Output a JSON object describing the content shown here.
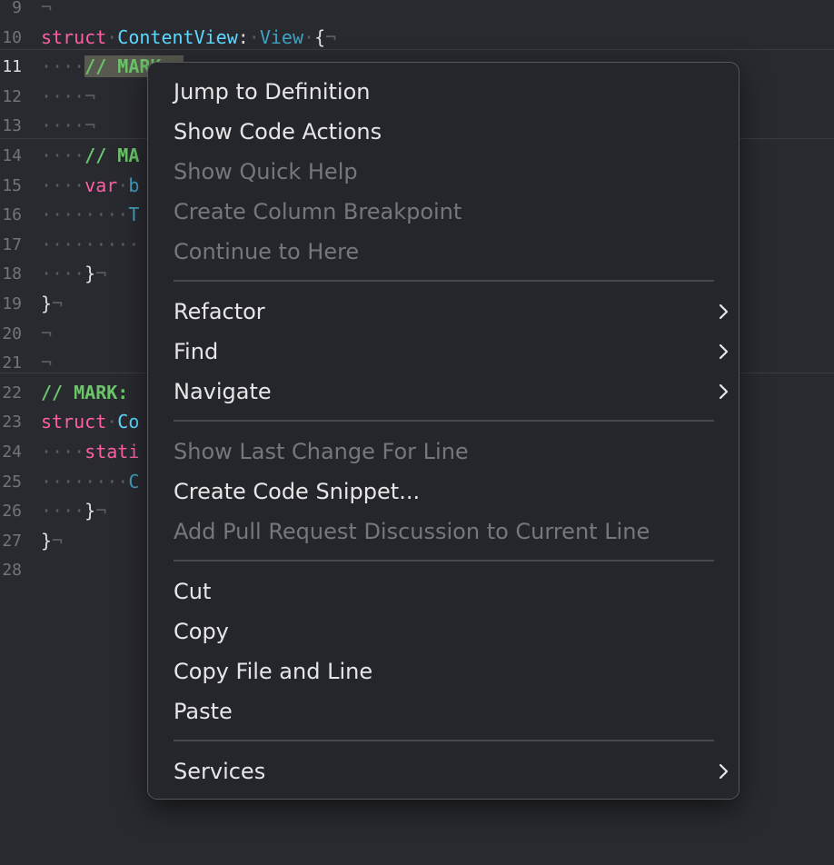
{
  "editor": {
    "lines": [
      {
        "num": "9",
        "code": [
          {
            "t": "¬",
            "c": "inv"
          }
        ]
      },
      {
        "num": "10",
        "code": [
          {
            "t": "struct",
            "c": "kw"
          },
          {
            "t": "·",
            "c": "inv"
          },
          {
            "t": "ContentView",
            "c": "type"
          },
          {
            "t": ":",
            "c": ""
          },
          {
            "t": "·",
            "c": "inv"
          },
          {
            "t": "View",
            "c": "type2"
          },
          {
            "t": "·",
            "c": "inv"
          },
          {
            "t": "{",
            "c": ""
          },
          {
            "t": "¬",
            "c": "inv"
          }
        ]
      },
      {
        "num": "11",
        "current": true,
        "code": [
          {
            "t": "····",
            "c": "inv"
          },
          {
            "t": "// MARK: ",
            "c": "mark hl"
          }
        ]
      },
      {
        "num": "12",
        "code": [
          {
            "t": "····¬",
            "c": "inv"
          }
        ]
      },
      {
        "num": "13",
        "code": [
          {
            "t": "····¬",
            "c": "inv"
          }
        ]
      },
      {
        "num": "14",
        "code": [
          {
            "t": "····",
            "c": "inv"
          },
          {
            "t": "// MA",
            "c": "mark"
          }
        ]
      },
      {
        "num": "15",
        "code": [
          {
            "t": "····",
            "c": "inv"
          },
          {
            "t": "var",
            "c": "kw"
          },
          {
            "t": "·",
            "c": "inv"
          },
          {
            "t": "b",
            "c": "type2"
          }
        ]
      },
      {
        "num": "16",
        "code": [
          {
            "t": "········",
            "c": "inv"
          },
          {
            "t": "T",
            "c": "type2"
          }
        ]
      },
      {
        "num": "17",
        "code": [
          {
            "t": "·········",
            "c": "inv"
          }
        ]
      },
      {
        "num": "18",
        "code": [
          {
            "t": "····",
            "c": "inv"
          },
          {
            "t": "}",
            "c": ""
          },
          {
            "t": "¬",
            "c": "inv"
          }
        ]
      },
      {
        "num": "19",
        "code": [
          {
            "t": "}",
            "c": ""
          },
          {
            "t": "¬",
            "c": "inv"
          }
        ]
      },
      {
        "num": "20",
        "code": [
          {
            "t": "¬",
            "c": "inv"
          }
        ]
      },
      {
        "num": "21",
        "code": [
          {
            "t": "¬",
            "c": "inv"
          }
        ]
      },
      {
        "num": "22",
        "code": [
          {
            "t": "// MARK: ",
            "c": "mark"
          }
        ]
      },
      {
        "num": "23",
        "code": [
          {
            "t": "struct",
            "c": "kw"
          },
          {
            "t": "·",
            "c": "inv"
          },
          {
            "t": "Co",
            "c": "type"
          }
        ]
      },
      {
        "num": "24",
        "code": [
          {
            "t": "····",
            "c": "inv"
          },
          {
            "t": "stati",
            "c": "kw"
          }
        ]
      },
      {
        "num": "25",
        "code": [
          {
            "t": "········",
            "c": "inv"
          },
          {
            "t": "C",
            "c": "type2"
          }
        ]
      },
      {
        "num": "26",
        "code": [
          {
            "t": "····",
            "c": "inv"
          },
          {
            "t": "}",
            "c": ""
          },
          {
            "t": "¬",
            "c": "inv"
          }
        ]
      },
      {
        "num": "27",
        "code": [
          {
            "t": "}",
            "c": ""
          },
          {
            "t": "¬",
            "c": "inv"
          }
        ]
      },
      {
        "num": "28",
        "code": []
      }
    ]
  },
  "menu": {
    "items": [
      {
        "label": "Jump to Definition",
        "enabled": true
      },
      {
        "label": "Show Code Actions",
        "enabled": true
      },
      {
        "label": "Show Quick Help",
        "enabled": false
      },
      {
        "label": "Create Column Breakpoint",
        "enabled": false
      },
      {
        "label": "Continue to Here",
        "enabled": false
      },
      {
        "separator": true
      },
      {
        "label": "Refactor",
        "enabled": true,
        "submenu": true
      },
      {
        "label": "Find",
        "enabled": true,
        "submenu": true
      },
      {
        "label": "Navigate",
        "enabled": true,
        "submenu": true
      },
      {
        "separator": true
      },
      {
        "label": "Show Last Change For Line",
        "enabled": false
      },
      {
        "label": "Create Code Snippet...",
        "enabled": true
      },
      {
        "label": "Add Pull Request Discussion to Current Line",
        "enabled": false
      },
      {
        "separator": true
      },
      {
        "label": "Cut",
        "enabled": true
      },
      {
        "label": "Copy",
        "enabled": true
      },
      {
        "label": "Copy File and Line",
        "enabled": true
      },
      {
        "label": "Paste",
        "enabled": true
      },
      {
        "separator": true
      },
      {
        "label": "Services",
        "enabled": true,
        "submenu": true
      }
    ]
  },
  "colors": {
    "background": "#292a30",
    "keyword": "#fc5fa3",
    "type": "#5dd8ff",
    "mark": "#6cc56a",
    "menu_bg": "#25262b",
    "disabled": "#76777c"
  }
}
